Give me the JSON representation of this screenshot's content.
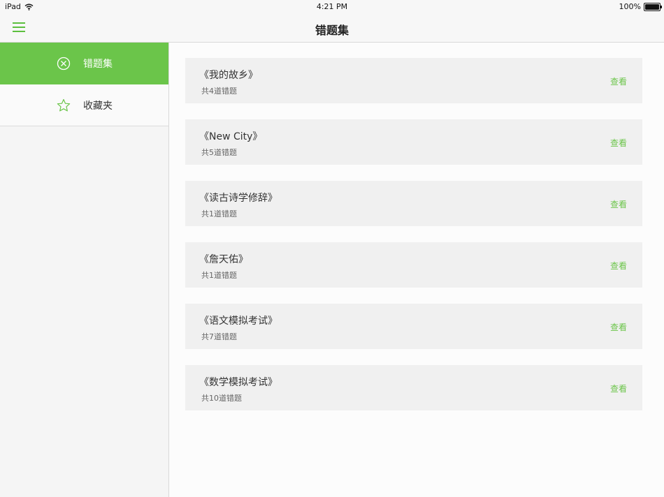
{
  "status_bar": {
    "device": "iPad",
    "time": "4:21 PM",
    "battery": "100%",
    "icons": [
      "wifi-icon",
      "battery-icon"
    ]
  },
  "nav": {
    "title": "错题集",
    "menu_icon": "hamburger-menu-icon"
  },
  "sidebar": {
    "items": [
      {
        "label": "错题集",
        "icon": "circle-x-icon",
        "active": true
      },
      {
        "label": "收藏夹",
        "icon": "star-icon",
        "active": false
      }
    ]
  },
  "list": {
    "items": [
      {
        "title": "《我的故乡》",
        "count": "共4道错题",
        "action": "查看"
      },
      {
        "title": "《New City》",
        "count": "共5道错题",
        "action": "查看"
      },
      {
        "title": "《读古诗学修辞》",
        "count": "共1道错题",
        "action": "查看"
      },
      {
        "title": "《詹天佑》",
        "count": "共1道错题",
        "action": "查看"
      },
      {
        "title": "《语文模拟考试》",
        "count": "共7道错题",
        "action": "查看"
      },
      {
        "title": "《数学模拟考试》",
        "count": "共10道错题",
        "action": "查看"
      }
    ]
  },
  "colors": {
    "accent": "#6bc54a",
    "card_bg": "#f0f0f0",
    "sidebar_bg": "#f5f5f5"
  }
}
